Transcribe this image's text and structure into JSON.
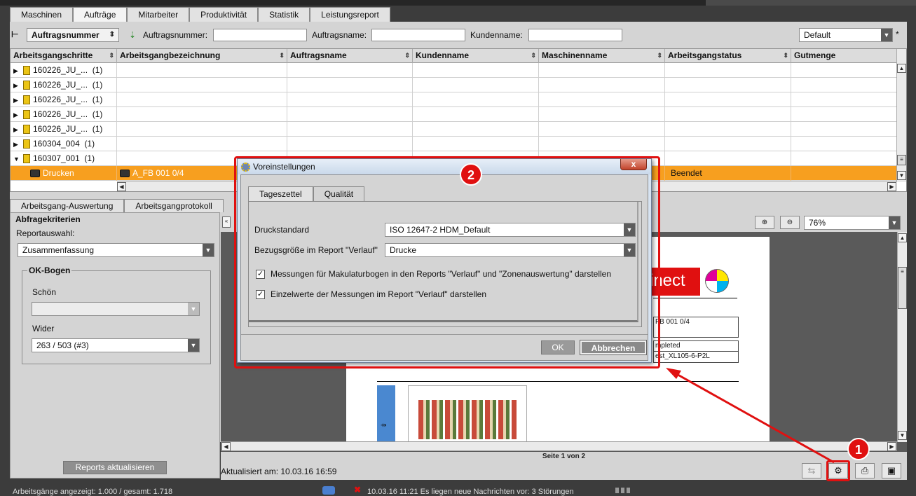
{
  "main_tabs": [
    "Maschinen",
    "Aufträge",
    "Mitarbeiter",
    "Produktivität",
    "Statistik",
    "Leistungsreport"
  ],
  "filter": {
    "sort_field": "Auftragsnummer",
    "auftragsnummer_label": "Auftragsnummer:",
    "auftragsname_label": "Auftragsname:",
    "kundenname_label": "Kundenname:",
    "preset": "Default",
    "asterisk": "*"
  },
  "grid": {
    "columns": [
      "Arbeitsgangschritte",
      "Arbeitsgangbezeichnung",
      "Auftragsname",
      "Kundenname",
      "Maschinenname",
      "Arbeitsgangstatus",
      "Gutmenge"
    ],
    "rows": [
      {
        "name": "160226_JU_...",
        "count": "(1)"
      },
      {
        "name": "160226_JU_...",
        "count": "(1)"
      },
      {
        "name": "160226_JU_...",
        "count": "(1)"
      },
      {
        "name": "160226_JU_...",
        "count": "(1)"
      },
      {
        "name": "160226_JU_...",
        "count": "(1)"
      },
      {
        "name": "160304_004",
        "count": "(1)"
      },
      {
        "name": "160307_001",
        "count": "(1)"
      }
    ],
    "selected_row": {
      "step": "Drucken",
      "designation": "A_FB 001  0/4",
      "status": "Beendet"
    }
  },
  "sub_tabs": [
    "Arbeitsgang-Auswertung",
    "Arbeitsgangprotokoll"
  ],
  "left_panel": {
    "group_title": "Abfragekriterien",
    "report_label": "Reportauswahl:",
    "report_value": "Zusammenfassung",
    "ok_title": "OK-Bogen",
    "schoen_label": "Schön",
    "schoen_value": "",
    "wider_label": "Wider",
    "wider_value": "263 / 503  (#3)",
    "update_button": "Reports aktualisieren"
  },
  "preview": {
    "zoom": "76%",
    "brand_text": "inect",
    "cell1": "FB 001  0/4",
    "cell2": "mpleted",
    "cell3": "est_XL105-6-P2L",
    "page_info": "Seite 1 von 2",
    "updated": "Aktualisiert am: 10.03.16 16:59"
  },
  "dialog": {
    "title": "Voreinstellungen",
    "close": "x",
    "tabs": [
      "Tageszettel",
      "Qualität"
    ],
    "druckstandard_label": "Druckstandard",
    "druckstandard_value": "ISO 12647-2 HDM_Default",
    "bezug_label": "Bezugsgröße im Report \"Verlauf\"",
    "bezug_value": "Drucke",
    "check1": "Messungen für Makulaturbogen in den Reports \"Verlauf\" und \"Zonenauswertung\" darstellen",
    "check2": "Einzelwerte der Messungen im Report \"Verlauf\" darstellen",
    "ok": "OK",
    "cancel": "Abbrechen"
  },
  "annotations": {
    "badge1": "1",
    "badge2": "2",
    "color": "#e01010"
  },
  "status": {
    "left": "Arbeitsgänge angezeigt: 1.000 / gesamt: 1.718",
    "right": "10.03.16 11:21  Es liegen neue Nachrichten vor: 3 Störungen"
  }
}
